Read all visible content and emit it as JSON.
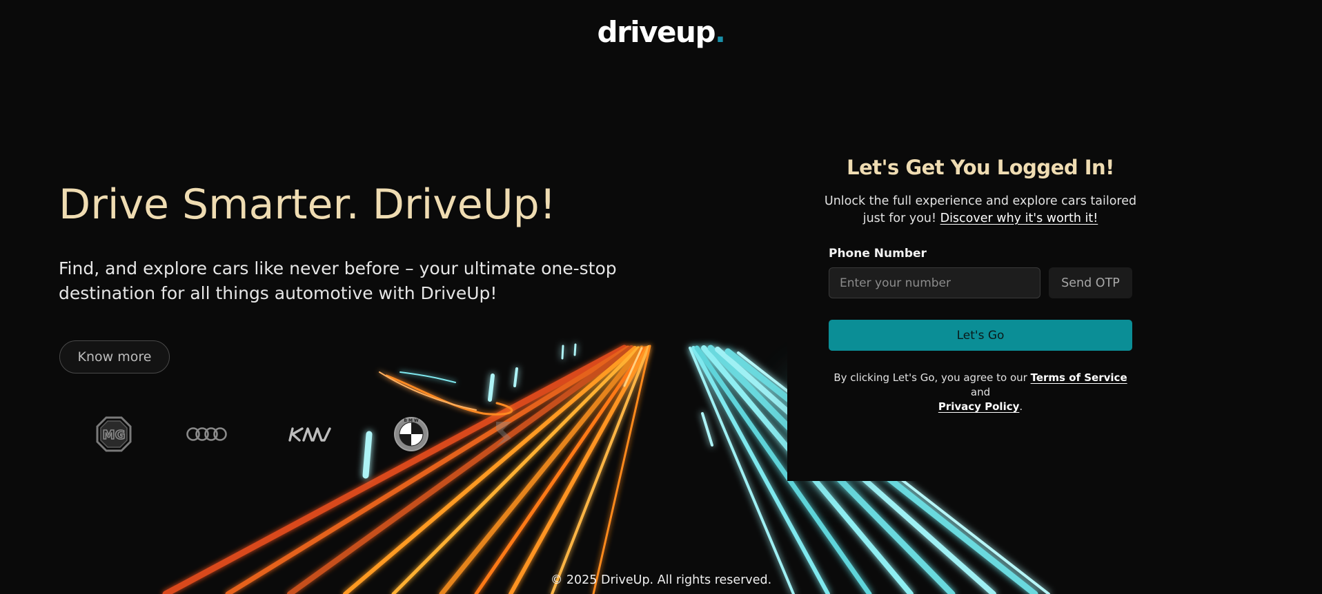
{
  "logo": {
    "text": "driveup",
    "dot": "."
  },
  "hero": {
    "title": "Drive Smarter. DriveUp!",
    "subtitle": "Find, and explore cars like never before – your ultimate one-stop destination for all things automotive with DriveUp!",
    "cta_label": "Know more"
  },
  "brands": [
    {
      "name": "MG",
      "icon": "mg-logo-icon"
    },
    {
      "name": "Audi",
      "icon": "audi-logo-icon"
    },
    {
      "name": "Kia",
      "icon": "kia-logo-icon"
    },
    {
      "name": "BMW",
      "icon": "bmw-logo-icon"
    },
    {
      "name": "Suzuki",
      "icon": "suzuki-logo-icon"
    }
  ],
  "login": {
    "title": "Let's Get You Logged In!",
    "description": "Unlock the full experience and explore cars tailored just for you!",
    "description_link": "Discover why it's worth it!",
    "phone_label": "Phone Number",
    "phone_placeholder": "Enter your number",
    "phone_value": "",
    "send_otp_label": "Send OTP",
    "submit_label": "Let's Go",
    "terms_prefix": "By clicking Let's Go, you agree to our",
    "terms_link": "Terms of Service",
    "terms_and": "and",
    "privacy_link": "Privacy Policy",
    "terms_suffix": "."
  },
  "footer": {
    "text": "© 2025 DriveUp. All rights reserved."
  },
  "colors": {
    "background": "#0a0a0a",
    "title_accent": "#efdcb2",
    "primary_button": "#0b8e96",
    "light_trail_orange": "#ff8a1a",
    "light_trail_cyan": "#7fe8ee"
  }
}
